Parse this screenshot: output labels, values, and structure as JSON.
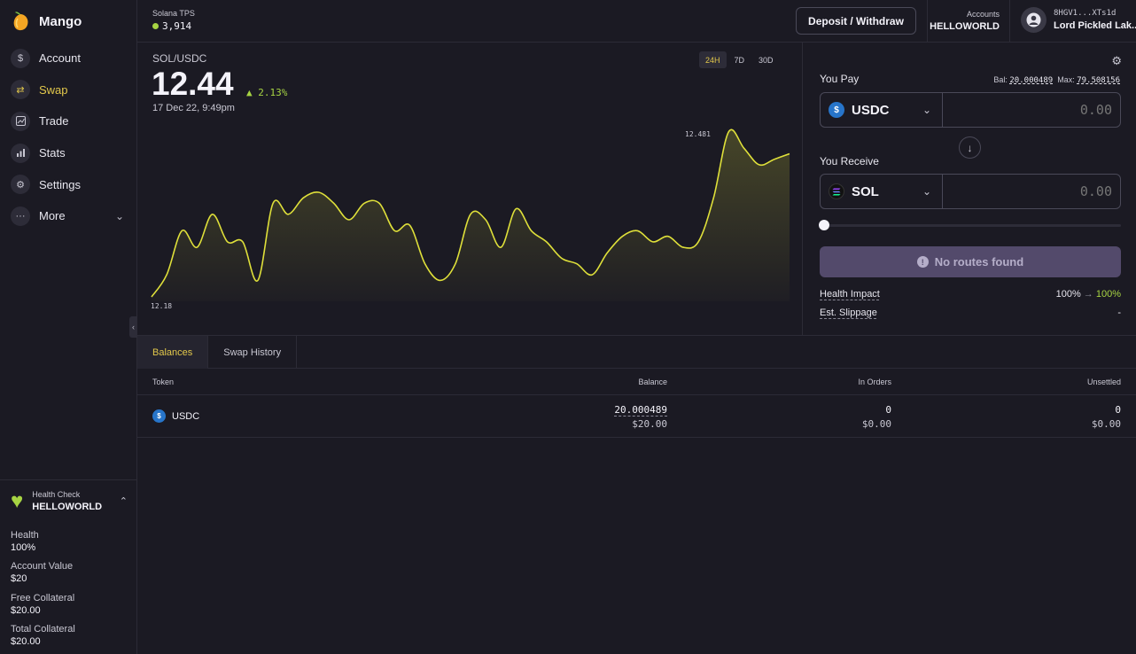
{
  "app": {
    "name": "Mango"
  },
  "sidebar": {
    "items": [
      {
        "label": "Account",
        "icon": "dollar-icon"
      },
      {
        "label": "Swap",
        "icon": "swap-icon",
        "active": true
      },
      {
        "label": "Trade",
        "icon": "trade-icon"
      },
      {
        "label": "Stats",
        "icon": "stats-icon"
      },
      {
        "label": "Settings",
        "icon": "gear-icon"
      },
      {
        "label": "More",
        "icon": "more-icon"
      }
    ]
  },
  "health_check": {
    "title": "Health Check",
    "account": "HELLOWORLD",
    "stats": [
      {
        "label": "Health",
        "value": "100%"
      },
      {
        "label": "Account Value",
        "value": "$20"
      },
      {
        "label": "Free Collateral",
        "value": "$20.00"
      },
      {
        "label": "Total Collateral",
        "value": "$20.00"
      }
    ]
  },
  "topbar": {
    "tps_label": "Solana TPS",
    "tps_value": "3,914",
    "deposit_label": "Deposit / Withdraw",
    "accounts_label": "Accounts",
    "accounts_value": "HELLOWORLD",
    "wallet_address": "8HGV1...XTs1d",
    "profile_name": "Lord Pickled Lak..."
  },
  "chart": {
    "pair": "SOL/USDC",
    "price": "12.44",
    "change": "2.13%",
    "date": "17 Dec 22, 9:49pm",
    "ranges": [
      "24H",
      "7D",
      "30D"
    ],
    "active_range": "24H",
    "max_label": "12.481",
    "min_label": "12.18",
    "line_color": "#dfe03a"
  },
  "chart_data": {
    "type": "area",
    "title": "SOL/USDC",
    "ylim": [
      12.18,
      12.481
    ],
    "values": [
      12.18,
      12.22,
      12.3,
      12.27,
      12.33,
      12.28,
      12.28,
      12.21,
      12.35,
      12.33,
      12.36,
      12.37,
      12.35,
      12.32,
      12.35,
      12.35,
      12.3,
      12.31,
      12.24,
      12.21,
      12.24,
      12.33,
      12.32,
      12.27,
      12.34,
      12.3,
      12.28,
      12.25,
      12.24,
      12.22,
      12.26,
      12.29,
      12.3,
      12.28,
      12.29,
      12.27,
      12.28,
      12.36,
      12.48,
      12.45,
      12.42,
      12.43,
      12.44
    ]
  },
  "swap": {
    "pay_label": "You Pay",
    "balance_label": "Bal:",
    "balance_value": "20.000489",
    "max_label": "Max:",
    "max_value": "79.508156",
    "pay_token": "USDC",
    "pay_amount": "0.00",
    "receive_label": "You Receive",
    "receive_token": "SOL",
    "receive_amount": "0.00",
    "button_label": "No routes found",
    "health_impact_label": "Health Impact",
    "health_impact_from": "100%",
    "health_impact_to": "100%",
    "slippage_label": "Est. Slippage",
    "slippage_value": "-"
  },
  "tabs": [
    "Balances",
    "Swap History"
  ],
  "balances": {
    "headers": [
      "Token",
      "Balance",
      "In Orders",
      "Unsettled"
    ],
    "rows": [
      {
        "token": "USDC",
        "balance": "20.000489",
        "balance_usd": "$20.00",
        "in_orders": "0",
        "in_orders_usd": "$0.00",
        "unsettled": "0",
        "unsettled_usd": "$0.00"
      }
    ]
  }
}
